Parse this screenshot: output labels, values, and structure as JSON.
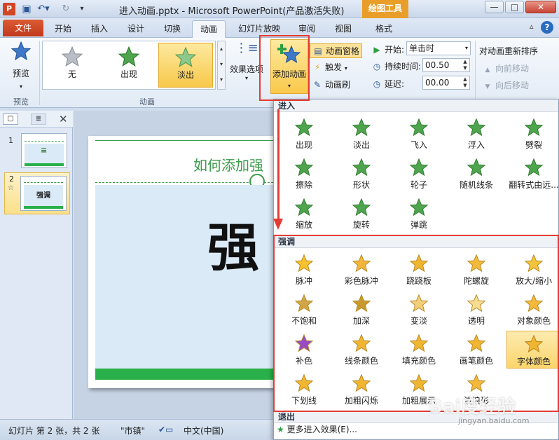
{
  "titlebar": {
    "app_logo": "P",
    "title": "进入动画.pptx - Microsoft PowerPoint(产品激活失败)",
    "context_tab": "绘图工具",
    "minimize": "—",
    "maximize": "□",
    "close": "✕"
  },
  "tabs": {
    "file": "文件",
    "items": [
      "开始",
      "插入",
      "设计",
      "切换",
      "动画",
      "幻灯片放映",
      "审阅",
      "视图",
      "格式"
    ],
    "active": "动画"
  },
  "ribbon": {
    "preview": {
      "label": "预览",
      "group": "预览"
    },
    "gallery": {
      "items": [
        {
          "label": "无"
        },
        {
          "label": "出现"
        },
        {
          "label": "淡出",
          "selected": true
        }
      ],
      "group": "动画"
    },
    "effect_options": "效果选项",
    "add_animation": "添加动画",
    "animation_pane": "动画窗格",
    "trigger": "触发",
    "animation_painter": "动画刷",
    "start_label": "开始:",
    "start_value": "单击时",
    "duration_label": "持续时间:",
    "duration_value": "00.50",
    "delay_label": "延迟:",
    "delay_value": "00.00",
    "reorder_title": "对动画重新排序",
    "move_earlier": "向前移动",
    "move_later": "向后移动"
  },
  "slides": [
    {
      "number": "1"
    },
    {
      "number": "2",
      "text": "强调"
    }
  ],
  "slide": {
    "title": "如何添加强",
    "word": "强"
  },
  "dropdown": {
    "entrance_title": "进入",
    "entrance": [
      "出现",
      "淡出",
      "飞入",
      "浮入",
      "劈裂",
      "擦除",
      "形状",
      "轮子",
      "随机线条",
      "翻转式由远...",
      "缩放",
      "旋转",
      "弹跳"
    ],
    "emphasis_title": "强调",
    "emphasis": [
      "脉冲",
      "彩色脉冲",
      "跷跷板",
      "陀螺旋",
      "放大/缩小",
      "不饱和",
      "加深",
      "变淡",
      "透明",
      "对象颜色",
      "补色",
      "线条颜色",
      "填充颜色",
      "画笔颜色",
      "字体颜色",
      "下划线",
      "加粗闪烁",
      "加粗展示",
      "波浪形"
    ],
    "emphasis_selected": "字体颜色",
    "exit_title": "退出",
    "more_effects": "更多进入效果(E)..."
  },
  "statusbar": {
    "slide_info": "幻灯片 第 2 张，共 2 张",
    "theme": "\"市镇\"",
    "language": "中文(中国)"
  },
  "watermark": {
    "text": "Bai度经验",
    "url": "jingyan.baidu.com"
  },
  "colors": {
    "accent": "#3a9b49",
    "highlight": "#e53b33",
    "file_tab": "#c0391c",
    "context_tab": "#e89e28"
  }
}
